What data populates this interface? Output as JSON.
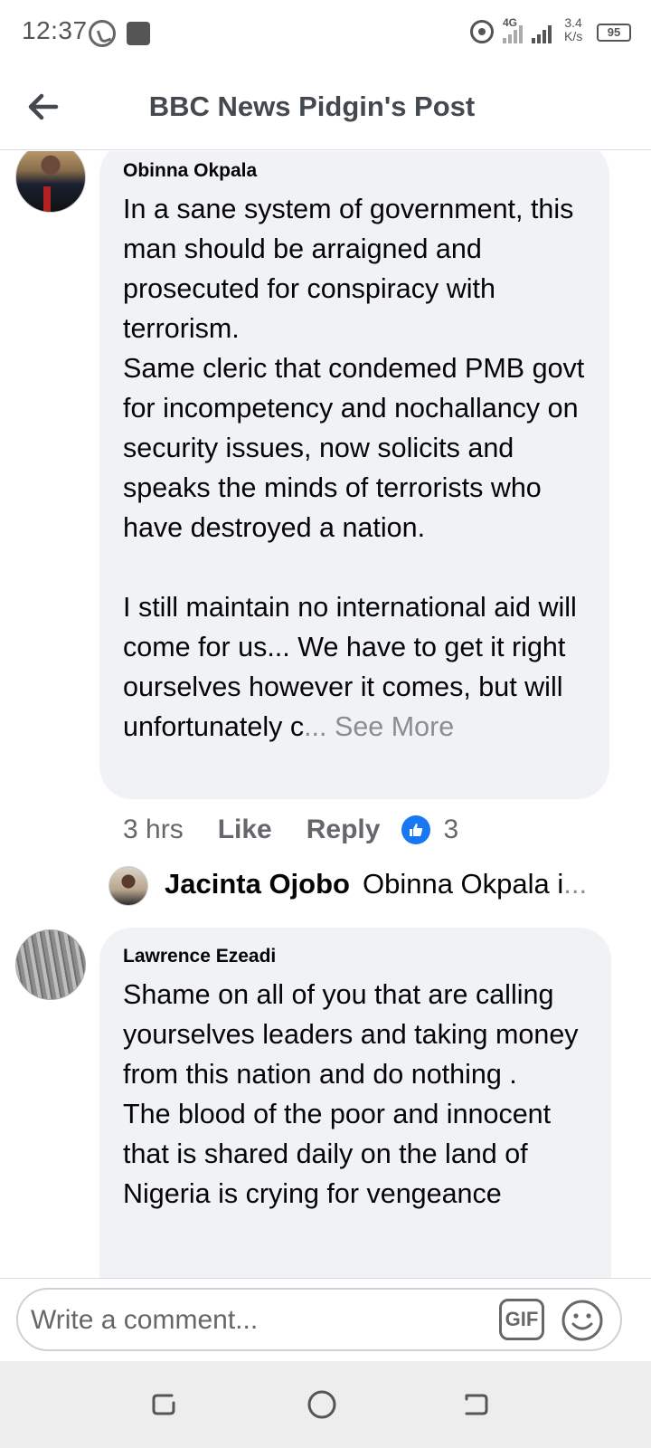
{
  "status_bar": {
    "time": "12:37",
    "network": "4G",
    "speed_value": "3.4",
    "speed_unit": "K/s",
    "battery": "95"
  },
  "header": {
    "title": "BBC News Pidgin's Post"
  },
  "comments": [
    {
      "author": "Obinna Okpala",
      "text": "In a sane system of government, this man should be arraigned and prosecuted for conspiracy with terrorism.\nSame cleric that condemed PMB govt for incompetency and nochallancy on security issues, now solicits and speaks the minds of terrorists who have destroyed a nation.\n\nI still maintain no international aid will come for us... We have to get it right ourselves however it comes, but will unfortunately c",
      "ellipsis": "...",
      "see_more": "See More",
      "time": "3 hrs",
      "like_label": "Like",
      "reply_label": "Reply",
      "like_count": "3",
      "reply_preview": {
        "author": "Jacinta Ojobo",
        "snippet": "Obinna Okpala i",
        "ellipsis": "..."
      }
    },
    {
      "author": "Lawrence Ezeadi",
      "text": "Shame on all of you that are calling yourselves leaders and taking money from this nation and do nothing .\nThe blood of the poor and innocent that is shared daily on the land of Nigeria is crying for vengeance"
    }
  ],
  "composer": {
    "placeholder": "Write a comment...",
    "gif_label": "GIF"
  },
  "icons": {
    "back": "back-arrow-icon",
    "like": "thumbs-up-icon",
    "emoji": "smiley-icon",
    "whatsapp": "whatsapp-icon",
    "hotspot": "hotspot-icon"
  },
  "colors": {
    "like_blue": "#1877f2",
    "bubble_bg": "#f0f2f5",
    "muted_text": "#65676b"
  }
}
